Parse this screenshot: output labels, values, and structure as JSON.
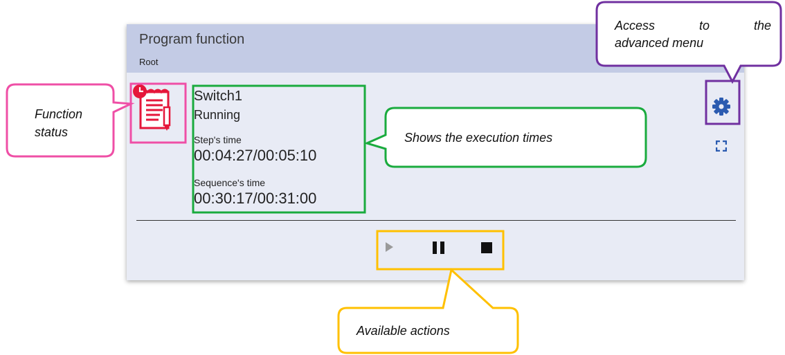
{
  "card": {
    "title": "Program function",
    "subtitle": "Root"
  },
  "function": {
    "name": "Switch1",
    "state": "Running",
    "step_label": "Step's time",
    "step_time": "00:04:27/00:05:10",
    "sequence_label": "Sequence's time",
    "sequence_time": "00:30:17/00:31:00",
    "status_icon": "program-running-icon"
  },
  "header_actions": {
    "settings_icon": "gear-icon",
    "fullscreen_icon": "fullscreen-icon"
  },
  "actions": [
    {
      "icon": "play-icon",
      "enabled": false
    },
    {
      "icon": "pause-icon",
      "enabled": true
    },
    {
      "icon": "stop-icon",
      "enabled": true
    }
  ],
  "annotations": {
    "function_status": "Function status",
    "execution_times": "Shows the execution times",
    "advanced_menu_line1": "Access to the",
    "advanced_menu_line2": "advanced menu",
    "available_actions": "Available actions"
  },
  "colors": {
    "header_bg": "#c3cbe5",
    "card_bg": "#e8ebf5",
    "icon_blue": "#2b5bb0",
    "status_red": "#e5163a",
    "annot_pink": "#ef4fa6",
    "annot_green": "#1aab3e",
    "annot_purple": "#7030a0",
    "annot_yellow": "#ffc000"
  }
}
